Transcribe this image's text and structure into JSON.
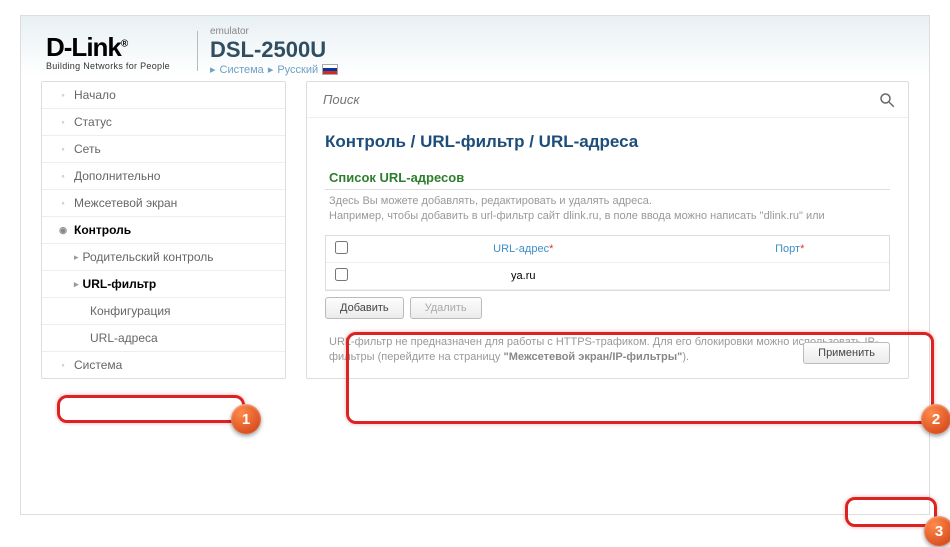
{
  "logo": {
    "main": "D-Link",
    "reg": "®",
    "tagline": "Building Networks for People"
  },
  "header": {
    "emulator": "emulator",
    "model": "DSL-2500U",
    "systemLabel": "Система",
    "langLabel": "Русский"
  },
  "search": {
    "placeholder": "Поиск"
  },
  "sidebar": {
    "items": [
      {
        "label": "Начало"
      },
      {
        "label": "Статус"
      },
      {
        "label": "Сеть"
      },
      {
        "label": "Дополнительно"
      },
      {
        "label": "Межсетевой экран"
      },
      {
        "label": "Контроль"
      },
      {
        "label": "Родительский контроль"
      },
      {
        "label": "URL-фильтр"
      },
      {
        "label": "Конфигурация"
      },
      {
        "label": "URL-адреса"
      },
      {
        "label": "Система"
      }
    ]
  },
  "breadcrumb": "Контроль  /  URL-фильтр  /  URL-адреса",
  "section": {
    "title": "Список URL-адресов",
    "help": "Здесь Вы можете добавлять, редактировать и удалять адреса.\nНапример, чтобы добавить в url-фильтр сайт dlink.ru, в поле ввода можно написать \"dlink.ru\" или"
  },
  "table": {
    "col1": "URL-адрес",
    "col2": "Порт",
    "rows": [
      {
        "url": "ya.ru",
        "port": ""
      }
    ]
  },
  "buttons": {
    "add": "Добавить",
    "delete": "Удалить",
    "apply": "Применить"
  },
  "note": {
    "text1": "URL-фильтр не предназначен для работы с HTTPS-трафиком. Для его блокировки можно использовать IP-фильтры (перейдите на страницу ",
    "bold": "\"Межсетевой экран/IP-фильтры\"",
    "text2": ")."
  },
  "badges": {
    "b1": "1",
    "b2": "2",
    "b3": "3"
  }
}
